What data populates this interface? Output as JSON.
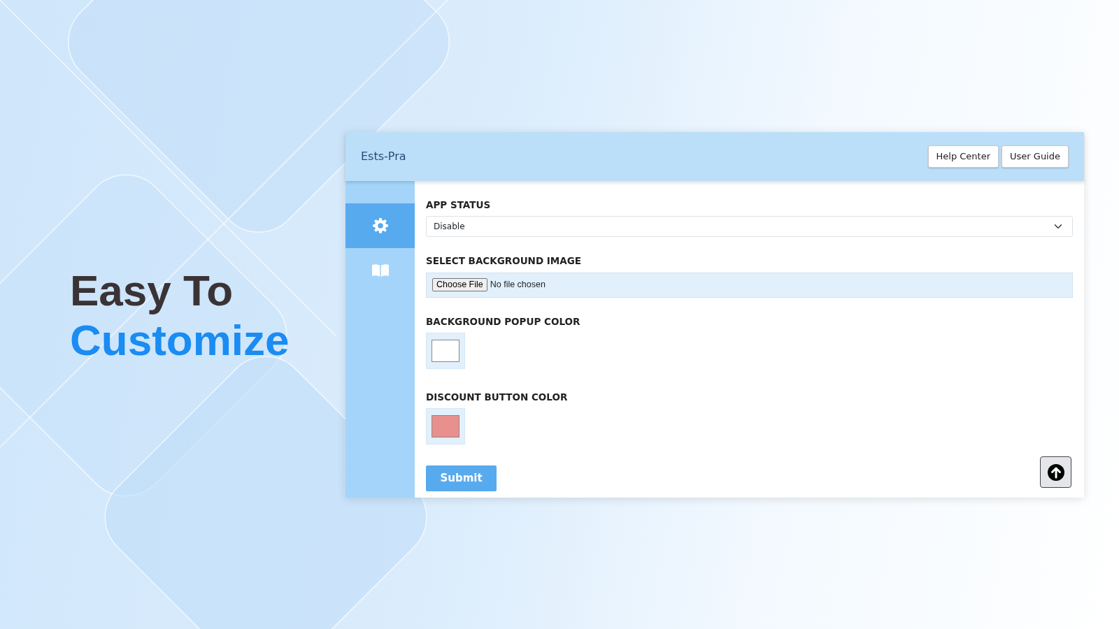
{
  "headline": {
    "line_1": "Easy To",
    "line_2": "Customize"
  },
  "app": {
    "title": "Ests-Pra",
    "header_buttons": [
      "Help Center",
      "User Guide"
    ],
    "sidebar": [
      {
        "kind": "gear",
        "selected": true
      },
      {
        "kind": "book",
        "selected": false
      }
    ],
    "fields": [
      {
        "kind": "select",
        "label": "APP STATUS",
        "value": "Disable"
      },
      {
        "kind": "file",
        "label": "SELECT BACKGROUND IMAGE",
        "button": "Choose File",
        "value": "No file chosen"
      },
      {
        "kind": "color",
        "label": "BACKGROUND POPUP COLOR",
        "color": "#ffffff"
      },
      {
        "kind": "color",
        "label": "DISCOUNT BUTTON COLOR",
        "color": "#e8908d"
      }
    ],
    "submit": "Submit"
  }
}
